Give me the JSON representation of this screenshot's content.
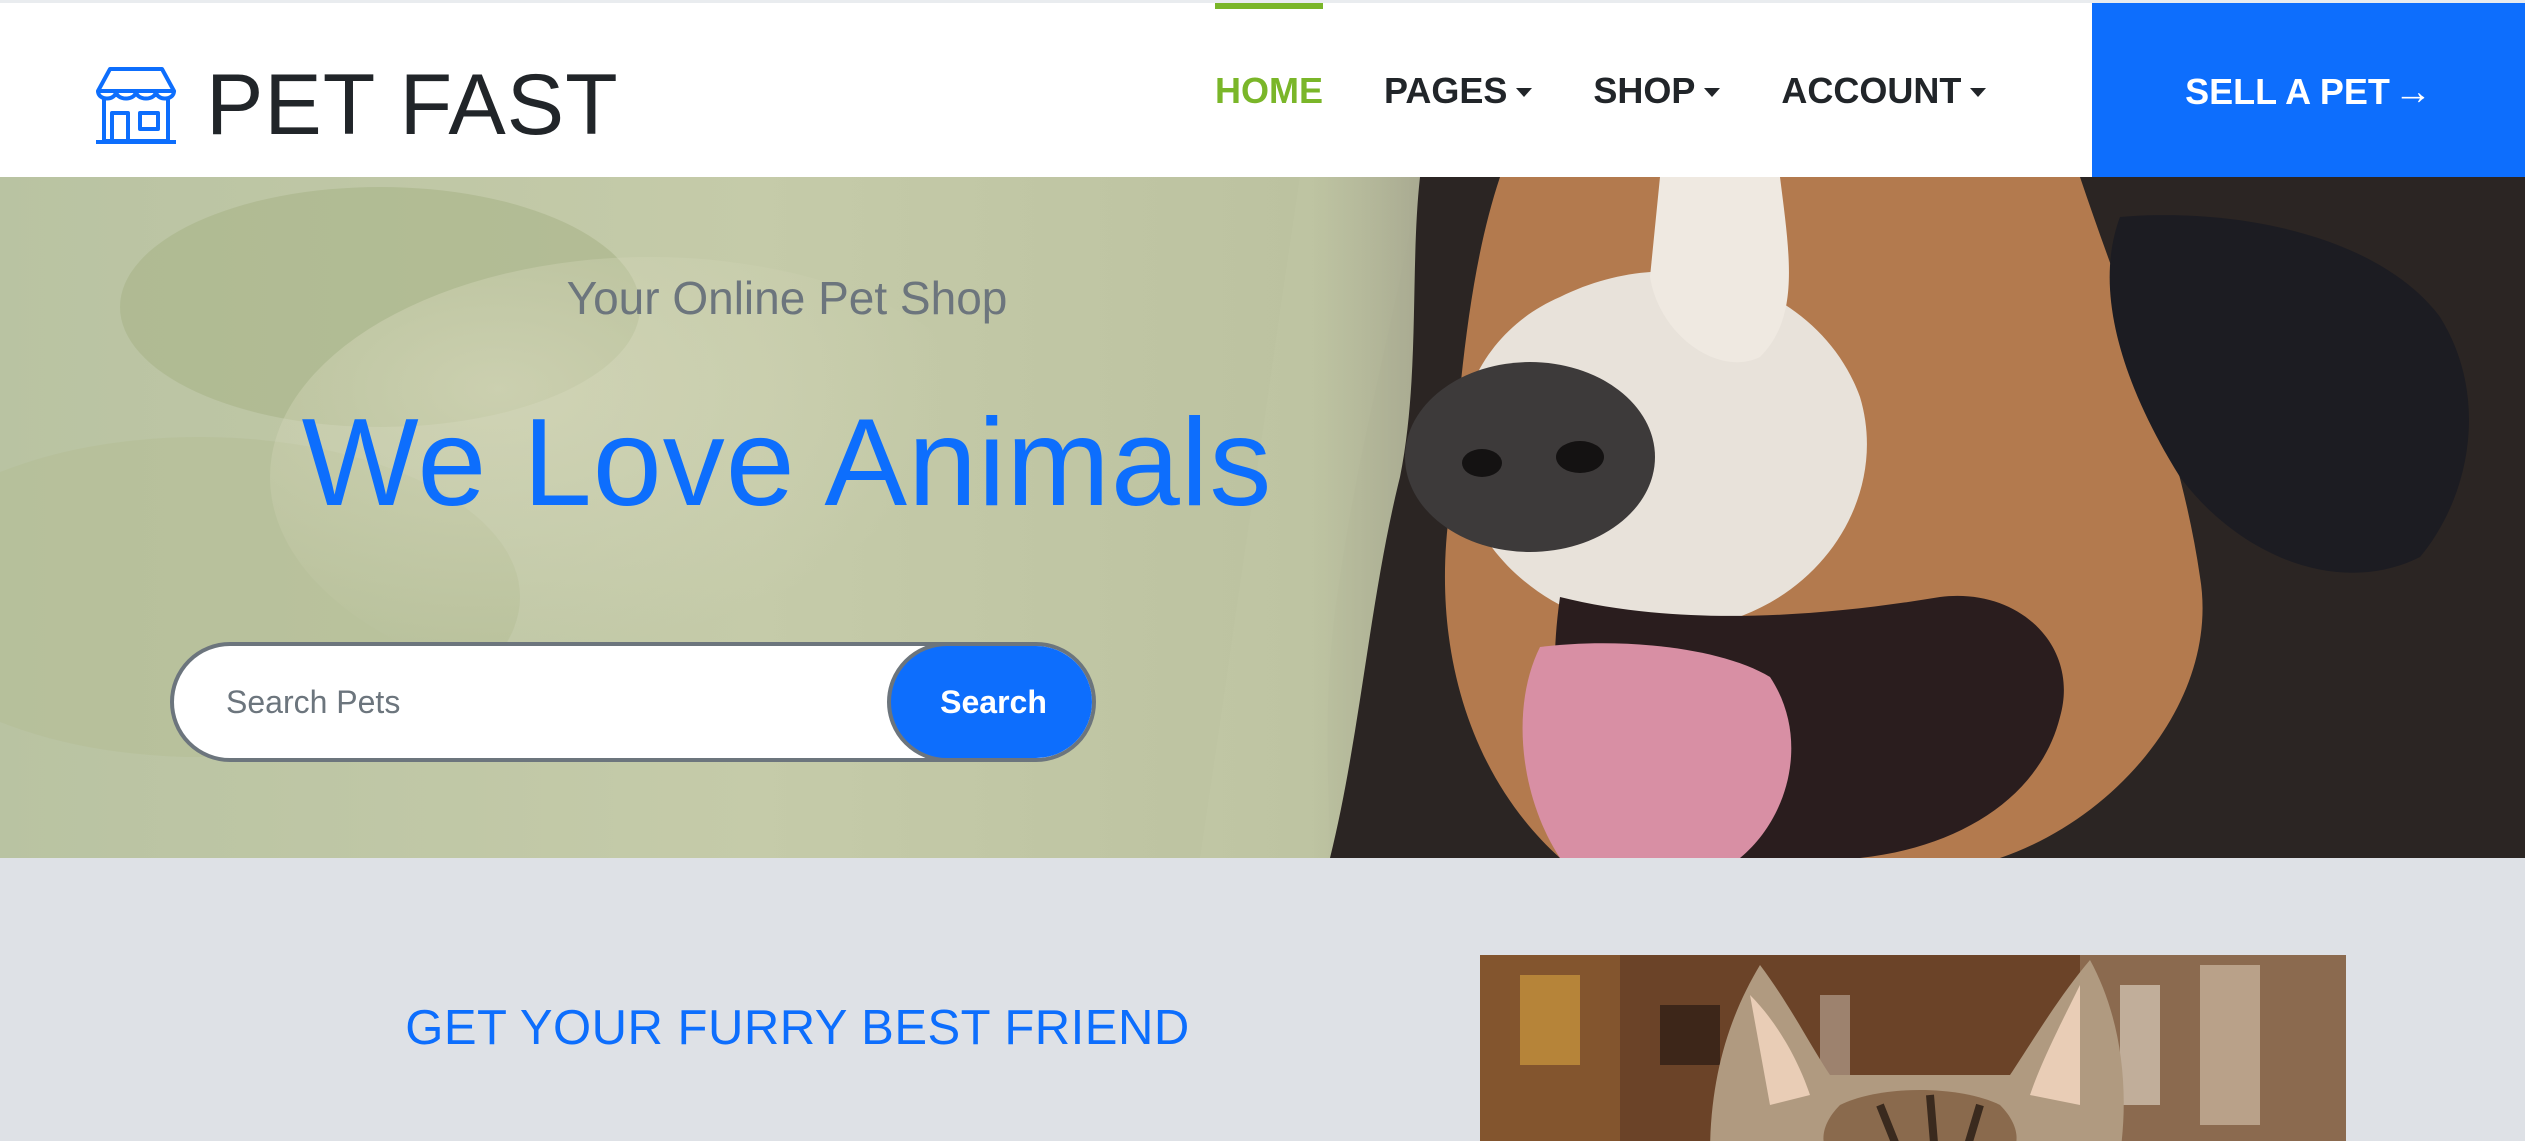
{
  "brand": {
    "name": "PET FAST",
    "icon": "storefront-icon"
  },
  "nav": {
    "items": [
      {
        "label": "HOME",
        "active": true,
        "dropdown": false
      },
      {
        "label": "PAGES",
        "active": false,
        "dropdown": true
      },
      {
        "label": "SHOP",
        "active": false,
        "dropdown": true
      },
      {
        "label": "ACCOUNT",
        "active": false,
        "dropdown": true
      }
    ],
    "cta_label": "SELL A PET",
    "cta_icon": "arrow-right-icon"
  },
  "hero": {
    "eyebrow": "Your Online Pet Shop",
    "title": "We Love Animals",
    "search": {
      "placeholder": "Search Pets",
      "value": "",
      "button_label": "Search"
    },
    "image": "dog-photo"
  },
  "section": {
    "heading": "GET YOUR FURRY BEST FRIEND",
    "image": "cat-photo"
  },
  "colors": {
    "primary": "#0d6efd",
    "active_nav": "#7ab629",
    "section_bg": "#dee1e6",
    "text_dark": "#212529",
    "text_muted": "#6c757d"
  }
}
